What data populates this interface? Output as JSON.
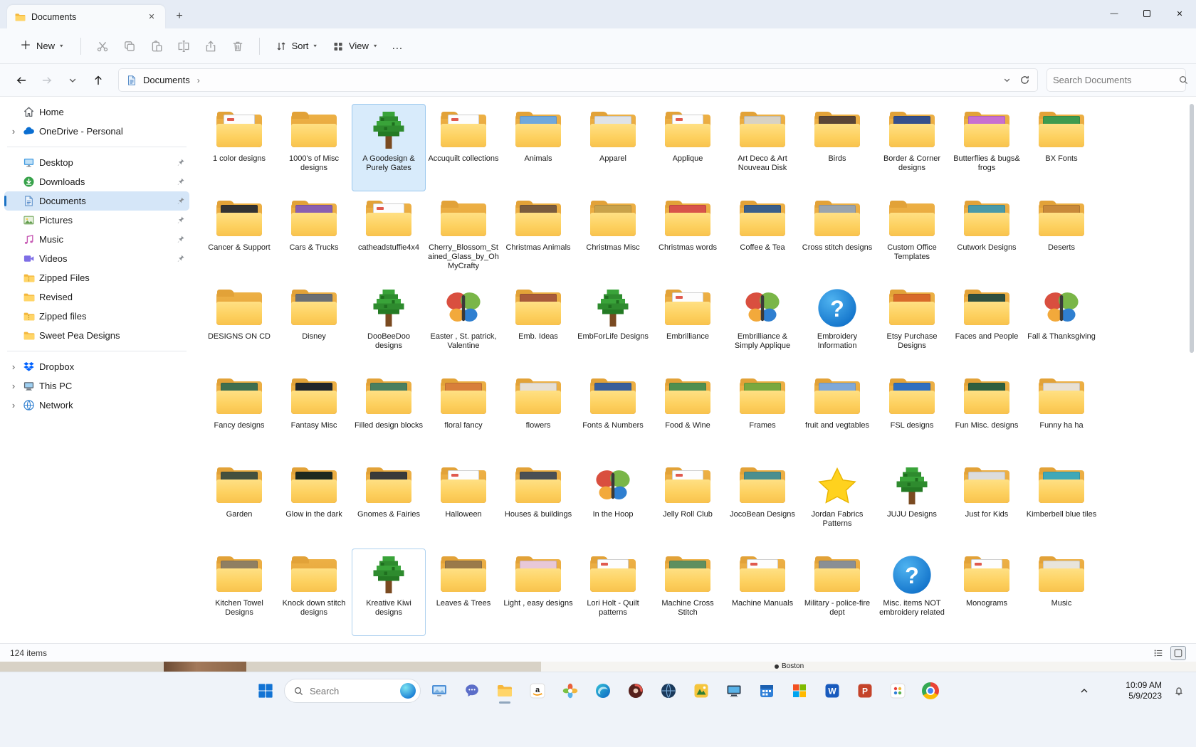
{
  "window": {
    "tab_title": "Documents"
  },
  "toolbar": {
    "new_label": "New",
    "sort_label": "Sort",
    "view_label": "View",
    "actions": [
      {
        "name": "cut"
      },
      {
        "name": "copy"
      },
      {
        "name": "paste"
      },
      {
        "name": "rename"
      },
      {
        "name": "share"
      },
      {
        "name": "delete"
      }
    ]
  },
  "address": {
    "path": "Documents",
    "search_placeholder": "Search Documents"
  },
  "sidebar": {
    "sections": [
      {
        "items": [
          {
            "label": "Home",
            "icon": "home"
          },
          {
            "label": "OneDrive - Personal",
            "icon": "onedrive",
            "chevron": true
          }
        ]
      },
      {
        "items": [
          {
            "label": "Desktop",
            "icon": "desktop",
            "pinned": true
          },
          {
            "label": "Downloads",
            "icon": "downloads",
            "pinned": true
          },
          {
            "label": "Documents",
            "icon": "documents",
            "pinned": true,
            "selected": true
          },
          {
            "label": "Pictures",
            "icon": "pictures",
            "pinned": true
          },
          {
            "label": "Music",
            "icon": "music",
            "pinned": true
          },
          {
            "label": "Videos",
            "icon": "videos",
            "pinned": true
          },
          {
            "label": "Zipped Files",
            "icon": "zip"
          },
          {
            "label": "Revised",
            "icon": "folder"
          },
          {
            "label": "Zipped files",
            "icon": "zip"
          },
          {
            "label": "Sweet Pea Designs",
            "icon": "folder"
          }
        ]
      },
      {
        "items": [
          {
            "label": "Dropbox",
            "icon": "dropbox",
            "chevron": true
          },
          {
            "label": "This PC",
            "icon": "thispc",
            "chevron": true
          },
          {
            "label": "Network",
            "icon": "network",
            "chevron": true
          }
        ]
      }
    ]
  },
  "folders": [
    {
      "n": "1 color designs",
      "t": "paper"
    },
    {
      "n": "1000's of Misc designs",
      "t": "plain"
    },
    {
      "n": "A Goodesign & Purely Gates",
      "t": "tree",
      "sel": true
    },
    {
      "n": "Accuquilt collections",
      "t": "paper"
    },
    {
      "n": "Animals",
      "t": "img",
      "c": "#6fa8dc"
    },
    {
      "n": "Apparel",
      "t": "img",
      "c": "#dfe3e8"
    },
    {
      "n": "Applique",
      "t": "paper"
    },
    {
      "n": "Art Deco & Art Nouveau Disk",
      "t": "img",
      "c": "#d8d2c4"
    },
    {
      "n": "Birds",
      "t": "img",
      "c": "#5b4636"
    },
    {
      "n": "Border & Corner designs",
      "t": "img",
      "c": "#35508c"
    },
    {
      "n": "Butterflies & bugs& frogs",
      "t": "img",
      "c": "#c86fd0"
    },
    {
      "n": "BX Fonts",
      "t": "img",
      "c": "#3e9b4f"
    },
    {
      "n": "Cancer & Support",
      "t": "img",
      "c": "#333333"
    },
    {
      "n": "Cars & Trucks",
      "t": "img",
      "c": "#8a5fb0"
    },
    {
      "n": "catheadstuffie4x4",
      "t": "paper"
    },
    {
      "n": "Cherry_Blossom_Stained_Glass_by_OhMyCrafty",
      "t": "plain"
    },
    {
      "n": "Christmas Animals",
      "t": "img",
      "c": "#7a5c3e"
    },
    {
      "n": "Christmas Misc",
      "t": "img",
      "c": "#c9a24a"
    },
    {
      "n": "Christmas words",
      "t": "img",
      "c": "#d8534a"
    },
    {
      "n": "Coffee & Tea",
      "t": "img",
      "c": "#3a5f8a"
    },
    {
      "n": "Cross stitch designs",
      "t": "img",
      "c": "#9aa4ad"
    },
    {
      "n": "Custom Office Templates",
      "t": "plain"
    },
    {
      "n": "Cutwork Designs",
      "t": "img",
      "c": "#4a9aa8"
    },
    {
      "n": "Deserts",
      "t": "img",
      "c": "#c8893a"
    },
    {
      "n": "DESIGNS ON CD",
      "t": "plain"
    },
    {
      "n": "Disney",
      "t": "img",
      "c": "#6b6f73"
    },
    {
      "n": "DooBeeDoo designs",
      "t": "tree"
    },
    {
      "n": "Easter , St. patrick, Valentine",
      "t": "bfly"
    },
    {
      "n": "Emb. Ideas",
      "t": "img",
      "c": "#a85a3a"
    },
    {
      "n": "EmbForLife Designs",
      "t": "tree"
    },
    {
      "n": "Embrilliance",
      "t": "paper"
    },
    {
      "n": "Embrilliance & Simply Applique",
      "t": "bfly"
    },
    {
      "n": "Embroidery Information",
      "t": "q"
    },
    {
      "n": "Etsy Purchase Designs",
      "t": "img",
      "c": "#d86a2a"
    },
    {
      "n": "Faces and People",
      "t": "img",
      "c": "#2f4f3f"
    },
    {
      "n": "Fall & Thanksgiving",
      "t": "bfly"
    },
    {
      "n": "Fancy designs",
      "t": "img",
      "c": "#3f6f4f"
    },
    {
      "n": "Fantasy Misc",
      "t": "img",
      "c": "#22262a"
    },
    {
      "n": "Filled design blocks",
      "t": "img",
      "c": "#4a7f5f"
    },
    {
      "n": "floral fancy",
      "t": "img",
      "c": "#d87f3a"
    },
    {
      "n": "flowers",
      "t": "img",
      "c": "#e6dfd4"
    },
    {
      "n": "Fonts  & Numbers",
      "t": "img",
      "c": "#3a5f9a"
    },
    {
      "n": "Food & Wine",
      "t": "img",
      "c": "#4f8f4f"
    },
    {
      "n": "Frames",
      "t": "img",
      "c": "#79a83f"
    },
    {
      "n": "fruit and vegtables",
      "t": "img",
      "c": "#7fa8d8"
    },
    {
      "n": "FSL designs",
      "t": "img",
      "c": "#2f6fc0"
    },
    {
      "n": "Fun Misc. designs",
      "t": "img",
      "c": "#2f5f3f"
    },
    {
      "n": "Funny ha ha",
      "t": "img",
      "c": "#e8e0d4"
    },
    {
      "n": "Garden",
      "t": "img",
      "c": "#44503e"
    },
    {
      "n": "Glow in the dark",
      "t": "img",
      "c": "#1f2a1f"
    },
    {
      "n": "Gnomes & Fairies",
      "t": "img",
      "c": "#3a3a3a"
    },
    {
      "n": "Halloween",
      "t": "paper"
    },
    {
      "n": "Houses  & buildings",
      "t": "img",
      "c": "#4a4f54"
    },
    {
      "n": "In the Hoop",
      "t": "bfly"
    },
    {
      "n": "Jelly Roll Club",
      "t": "paper"
    },
    {
      "n": "JocoBean Designs",
      "t": "img",
      "c": "#4a8f8f"
    },
    {
      "n": "Jordan Fabrics Patterns",
      "t": "star"
    },
    {
      "n": "JUJU Designs",
      "t": "tree"
    },
    {
      "n": "Just for Kids",
      "t": "img",
      "c": "#dcdcdc"
    },
    {
      "n": "Kimberbell blue tiles",
      "t": "img",
      "c": "#3fa8b8"
    },
    {
      "n": "Kitchen Towel Designs",
      "t": "img",
      "c": "#8f7f62"
    },
    {
      "n": "Knock down stitch designs",
      "t": "plain"
    },
    {
      "n": "Kreative Kiwi designs",
      "t": "tree",
      "foc": true
    },
    {
      "n": "Leaves & Trees",
      "t": "img",
      "c": "#9a7a4a"
    },
    {
      "n": "Light , easy designs",
      "t": "img",
      "c": "#e8c8d8"
    },
    {
      "n": "Lori Holt - Quilt patterns",
      "t": "paper"
    },
    {
      "n": "Machine Cross Stitch",
      "t": "img",
      "c": "#5f8f5f"
    },
    {
      "n": "Machine Manuals",
      "t": "paper"
    },
    {
      "n": "Military - police-fire dept",
      "t": "img",
      "c": "#8a8f94"
    },
    {
      "n": "Misc. items NOT embroidery related",
      "t": "q"
    },
    {
      "n": "Monograms",
      "t": "paper"
    },
    {
      "n": "Music",
      "t": "img",
      "c": "#e8e4da"
    }
  ],
  "status": {
    "items_text": "124 items"
  },
  "desktop_peek": {
    "label": "Boston"
  },
  "taskbar": {
    "search_placeholder": "Search",
    "time": "10:09 AM",
    "date": "5/9/2023",
    "apps": [
      {
        "name": "monitor-app"
      },
      {
        "name": "teams-chat"
      },
      {
        "name": "file-explorer",
        "active": true
      },
      {
        "name": "amazon"
      },
      {
        "name": "photos"
      },
      {
        "name": "edge"
      },
      {
        "name": "media-app"
      },
      {
        "name": "globe-app"
      },
      {
        "name": "gallery-app"
      },
      {
        "name": "pc-app"
      },
      {
        "name": "calendar-app"
      },
      {
        "name": "microsoft-app"
      },
      {
        "name": "word"
      },
      {
        "name": "powerpoint"
      },
      {
        "name": "paint-app"
      },
      {
        "name": "chrome"
      }
    ]
  }
}
